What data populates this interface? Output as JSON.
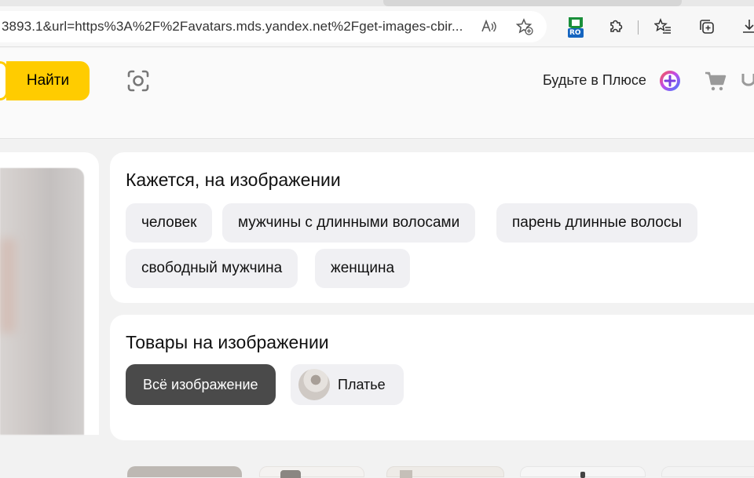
{
  "browser": {
    "url": "3893.1&url=https%3A%2F%2Favatars.mds.yandex.net%2Fget-images-cbir...",
    "extension_badge": "RO"
  },
  "header": {
    "find_button": "Найти",
    "plus_link": "Будьте в Плюсе"
  },
  "recognition": {
    "title": "Кажется, на изображении",
    "tags": [
      "человек",
      "мужчины с длинными волосами",
      "парень длинные волосы",
      "свободный мужчина",
      "женщина"
    ]
  },
  "products": {
    "title": "Товары на изображении",
    "filters": [
      "Всё изображение",
      "Платье"
    ]
  },
  "colors": {
    "accent": "#ffcc00",
    "chip_bg": "#f0f0f3",
    "chip_active": "#4a4a4a"
  }
}
